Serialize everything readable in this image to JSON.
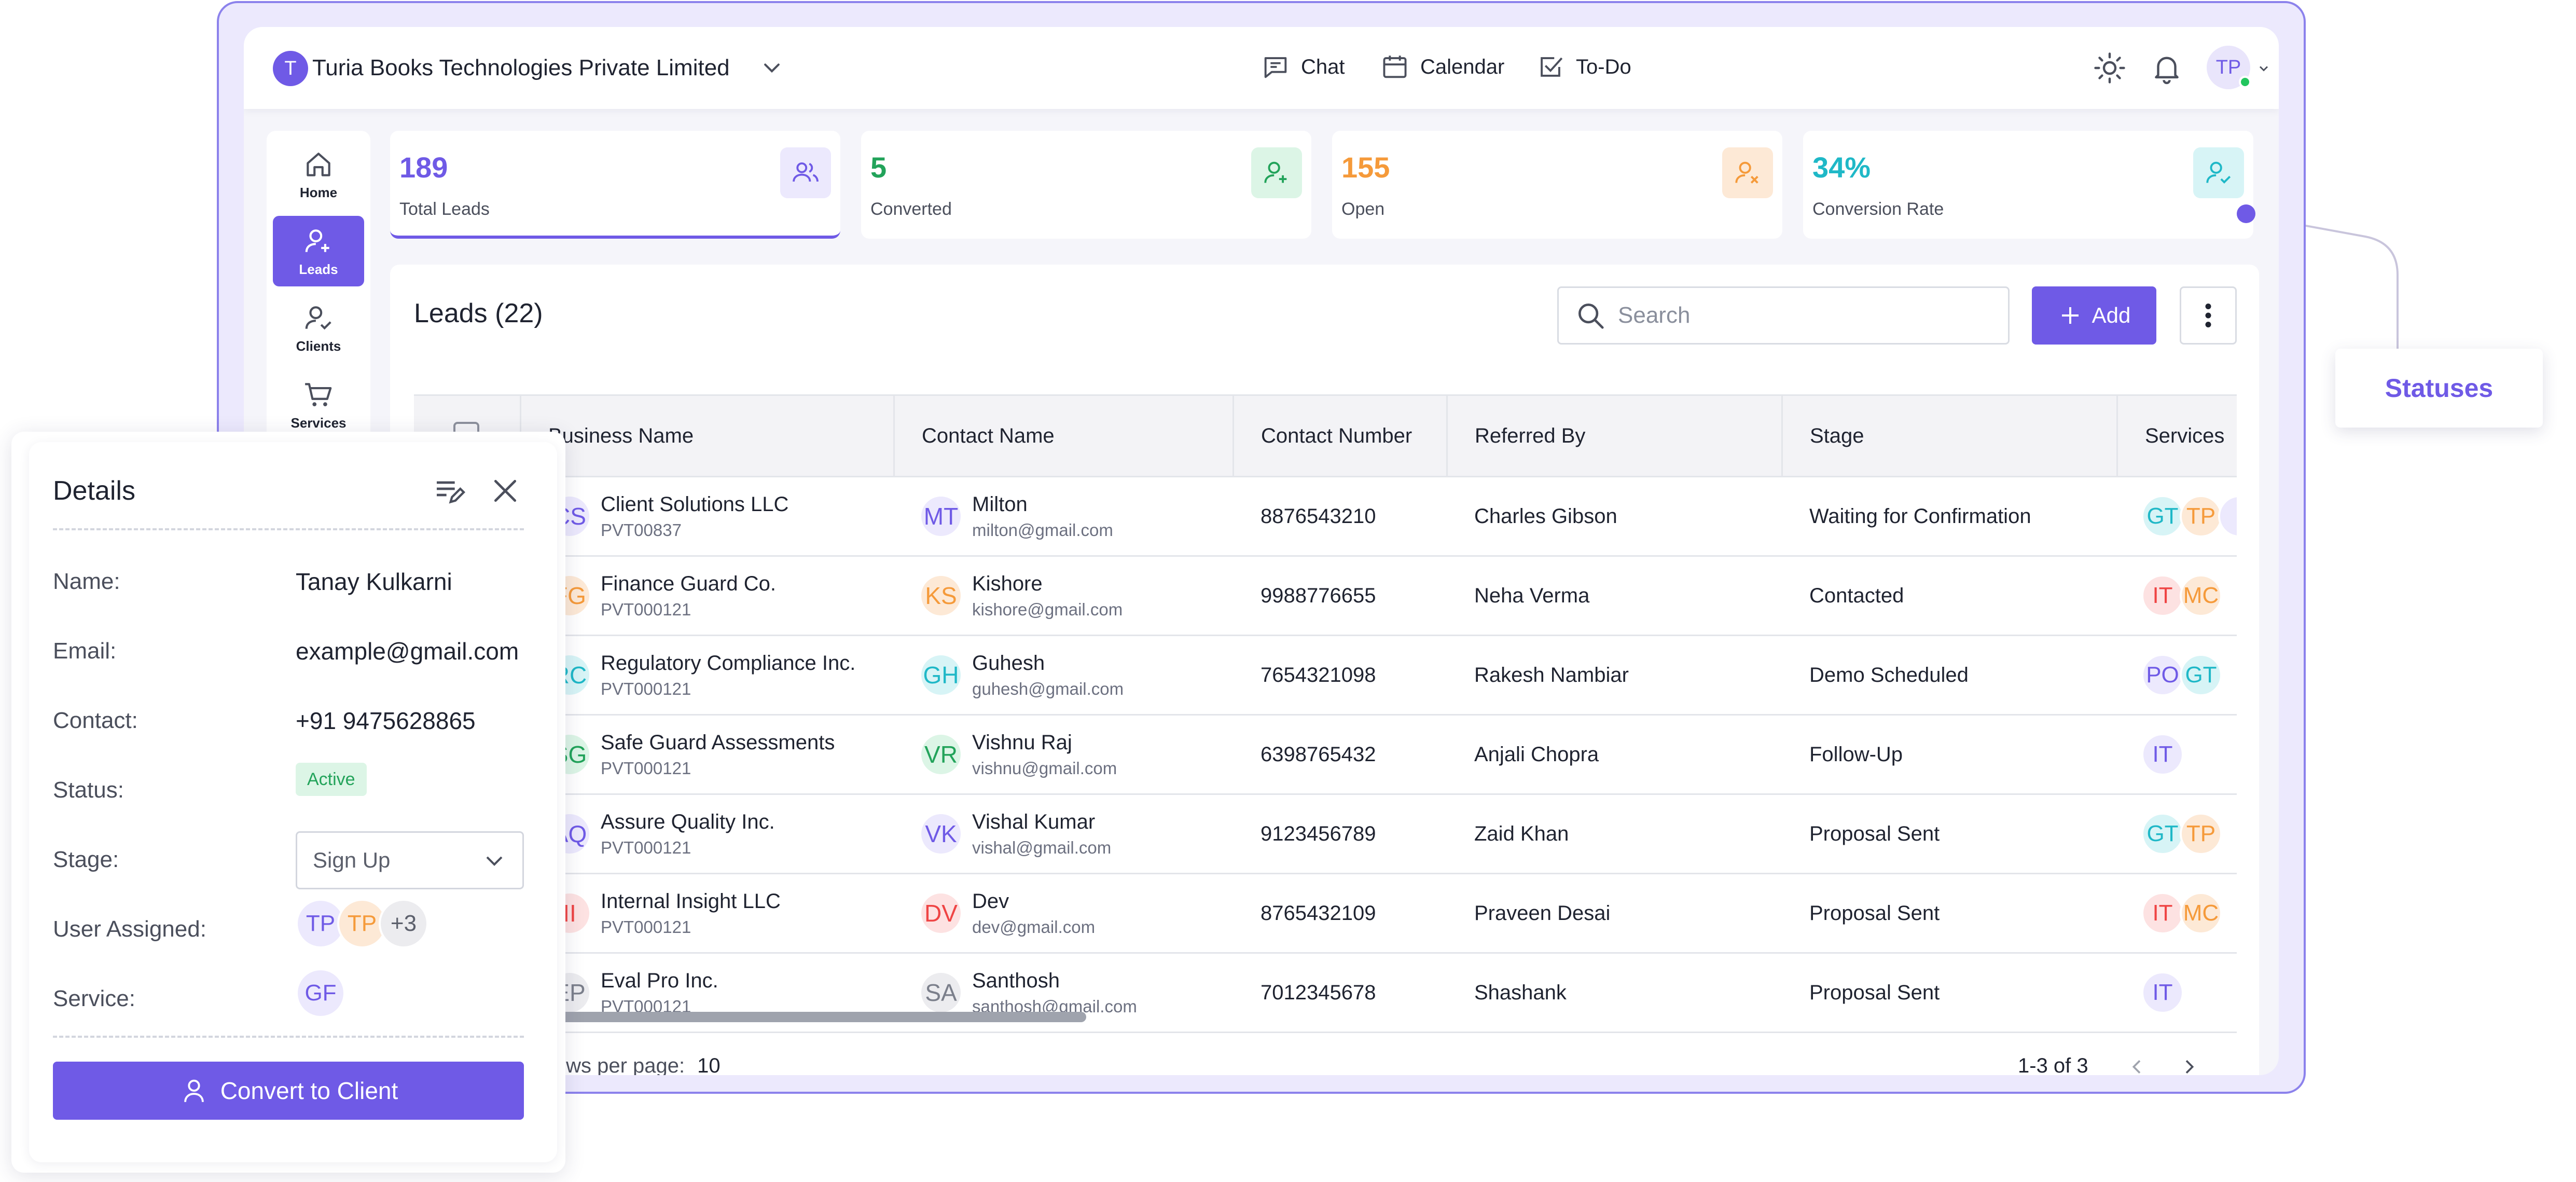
{
  "header": {
    "org_initial": "T",
    "org_name": "Turia Books Technologies Private Limited",
    "nav": {
      "chat": "Chat",
      "calendar": "Calendar",
      "todo": "To-Do"
    },
    "avatar_initials": "TP"
  },
  "sidebar": {
    "items": [
      {
        "label": "Home",
        "icon": "home-icon"
      },
      {
        "label": "Leads",
        "icon": "user-plus-icon",
        "active": true
      },
      {
        "label": "Clients",
        "icon": "user-check-icon"
      },
      {
        "label": "Services",
        "icon": "cart-icon"
      }
    ]
  },
  "stats": [
    {
      "value": "189",
      "label": "Total Leads",
      "color": "#6f5ae6",
      "bg": "#ece9fd",
      "icon": "users-icon"
    },
    {
      "value": "5",
      "label": "Converted",
      "color": "#22a35a",
      "bg": "#dcf5e6",
      "icon": "user-add-icon"
    },
    {
      "value": "155",
      "label": "Open",
      "color": "#f59a3a",
      "bg": "#fde9d6",
      "icon": "user-x-icon"
    },
    {
      "value": "34%",
      "label": "Conversion Rate",
      "color": "#1fb8c7",
      "bg": "#d7f4f6",
      "icon": "user-check-icon"
    }
  ],
  "leads": {
    "title": "Leads (22)",
    "search_placeholder": "Search",
    "add_label": "Add",
    "columns": [
      "Business Name",
      "Contact Name",
      "Contact Number",
      "Referred By",
      "Stage",
      "Services"
    ],
    "rows": [
      {
        "biz_initials": "CS",
        "biz_color": "#6f5ae6",
        "biz_bg": "#ece9fd",
        "business": "Client Solutions LLC",
        "code": "PVT00837",
        "contact_initials": "MT",
        "contact_color": "#6f5ae6",
        "contact_bg": "#ece9fd",
        "contact": "Milton",
        "email": "milton@gmail.com",
        "number": "8876543210",
        "referred": "Charles Gibson",
        "stage": "Waiting for Confirmation",
        "services": [
          {
            "t": "GT",
            "c": "#1fb8c7",
            "b": "#d7f4f6"
          },
          {
            "t": "TP",
            "c": "#f59a3a",
            "b": "#fde9d6"
          },
          {
            "t": "",
            "c": "#6f5ae6",
            "b": "#ece9fd"
          }
        ]
      },
      {
        "biz_initials": "FG",
        "biz_color": "#f59a3a",
        "biz_bg": "#fde9d6",
        "business": "Finance Guard Co.",
        "code": "PVT000121",
        "contact_initials": "KS",
        "contact_color": "#f59a3a",
        "contact_bg": "#fde9d6",
        "contact": "Kishore",
        "email": "kishore@gmail.com",
        "number": "9988776655",
        "referred": "Neha Verma",
        "stage": "Contacted",
        "services": [
          {
            "t": "IT",
            "c": "#ef4444",
            "b": "#fde2e2"
          },
          {
            "t": "MC",
            "c": "#f59a3a",
            "b": "#fde9d6"
          }
        ]
      },
      {
        "biz_initials": "RC",
        "biz_color": "#1fb8c7",
        "biz_bg": "#d7f4f6",
        "business": "Regulatory Compliance Inc.",
        "code": "PVT000121",
        "contact_initials": "GH",
        "contact_color": "#1fb8c7",
        "contact_bg": "#d7f4f6",
        "contact": "Guhesh",
        "email": "guhesh@gmail.com",
        "number": "7654321098",
        "referred": "Rakesh Nambiar",
        "stage": "Demo Scheduled",
        "services": [
          {
            "t": "PO",
            "c": "#6f5ae6",
            "b": "#ece9fd"
          },
          {
            "t": "GT",
            "c": "#1fb8c7",
            "b": "#d7f4f6"
          }
        ]
      },
      {
        "biz_initials": "SG",
        "biz_color": "#22a35a",
        "biz_bg": "#dcf5e6",
        "business": "Safe Guard Assessments",
        "code": "PVT000121",
        "contact_initials": "VR",
        "contact_color": "#22a35a",
        "contact_bg": "#dcf5e6",
        "contact": "Vishnu Raj",
        "email": "vishnu@gmail.com",
        "number": "6398765432",
        "referred": "Anjali Chopra",
        "stage": "Follow-Up",
        "services": [
          {
            "t": "IT",
            "c": "#6f5ae6",
            "b": "#ece9fd"
          }
        ]
      },
      {
        "biz_initials": "AQ",
        "biz_color": "#6f5ae6",
        "biz_bg": "#ece9fd",
        "business": "Assure Quality Inc.",
        "code": "PVT000121",
        "contact_initials": "VK",
        "contact_color": "#6f5ae6",
        "contact_bg": "#ece9fd",
        "contact": "Vishal Kumar",
        "email": "vishal@gmail.com",
        "number": "9123456789",
        "referred": "Zaid Khan",
        "stage": "Proposal Sent",
        "services": [
          {
            "t": "GT",
            "c": "#1fb8c7",
            "b": "#d7f4f6"
          },
          {
            "t": "TP",
            "c": "#f59a3a",
            "b": "#fde9d6"
          }
        ]
      },
      {
        "biz_initials": "II",
        "biz_color": "#ef4444",
        "biz_bg": "#fde2e2",
        "business": "Internal Insight LLC",
        "code": "PVT000121",
        "contact_initials": "DV",
        "contact_color": "#ef4444",
        "contact_bg": "#fde2e2",
        "contact": "Dev",
        "email": "dev@gmail.com",
        "number": "8765432109",
        "referred": "Praveen Desai",
        "stage": "Proposal Sent",
        "services": [
          {
            "t": "IT",
            "c": "#ef4444",
            "b": "#fde2e2"
          },
          {
            "t": "MC",
            "c": "#f59a3a",
            "b": "#fde9d6"
          }
        ]
      },
      {
        "biz_initials": "EP",
        "biz_color": "#7b7f8b",
        "biz_bg": "#ececef",
        "business": "Eval Pro Inc.",
        "code": "PVT000121",
        "contact_initials": "SA",
        "contact_color": "#7b7f8b",
        "contact_bg": "#ececef",
        "contact": "Santhosh",
        "email": "santhosh@gmail.com",
        "number": "7012345678",
        "referred": "Shashank",
        "stage": "Proposal Sent",
        "services": [
          {
            "t": "IT",
            "c": "#6f5ae6",
            "b": "#ece9fd"
          }
        ]
      }
    ],
    "rows_per_page_label": "Rows per page:",
    "rows_per_page": "10",
    "range": "1-3 of 3"
  },
  "details": {
    "title": "Details",
    "fields": {
      "name_label": "Name:",
      "name": "Tanay Kulkarni",
      "email_label": "Email:",
      "email": "example@gmail.com",
      "contact_label": "Contact:",
      "contact": "+91 9475628865",
      "status_label": "Status:",
      "status": "Active",
      "stage_label": "Stage:",
      "stage": "Sign Up",
      "users_label": "User Assigned:",
      "service_label": "Service:"
    },
    "users": [
      {
        "t": "TP",
        "c": "#6f5ae6",
        "b": "#ece9fd"
      },
      {
        "t": "TP",
        "c": "#f59a3a",
        "b": "#fde9d6"
      },
      {
        "t": "+3",
        "c": "#5c606c",
        "b": "#ececef"
      }
    ],
    "services": [
      {
        "t": "GF",
        "c": "#6f5ae6",
        "b": "#ece9fd"
      }
    ],
    "convert_label": "Convert to Client"
  },
  "callout": {
    "label": "Statuses"
  },
  "colors": {
    "accent": "#6f5ae6",
    "frame": "#8c82ec"
  }
}
